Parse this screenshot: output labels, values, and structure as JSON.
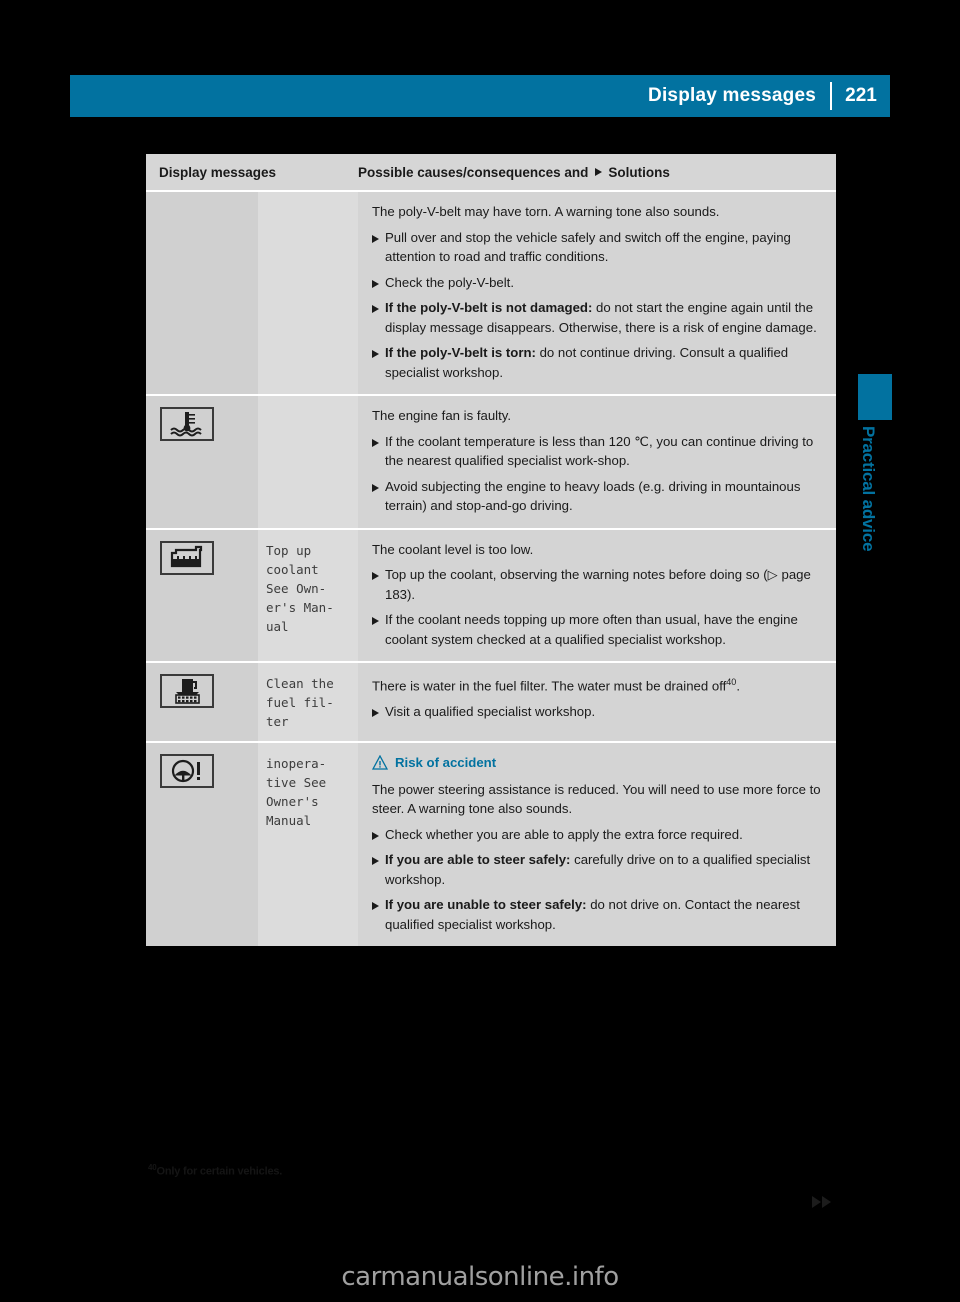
{
  "header": {
    "title": "Display messages",
    "page_number": "221",
    "accent_color": "#0272a0"
  },
  "sidebar": {
    "section_label": "Practical advice"
  },
  "table": {
    "columns": [
      "Display messages",
      "Possible causes/consequences and",
      "Solutions"
    ],
    "rows": [
      {
        "icon_name": "none",
        "display_message": "",
        "intro": "The poly-V-belt may have torn. A warning tone also sounds.",
        "warning": null,
        "bullets": [
          {
            "bold": "",
            "text": "Pull over and stop the vehicle safely and switch off the engine, paying attention to road and traffic conditions."
          },
          {
            "bold": "",
            "text": "Check the poly-V-belt."
          },
          {
            "bold": "If the poly-V-belt is not damaged:",
            "text": " do not start the engine again until the display message disappears. Otherwise, there is a risk of engine damage."
          },
          {
            "bold": "If the poly-V-belt is torn:",
            "text": " do not continue driving. Consult a qualified specialist workshop."
          }
        ]
      },
      {
        "icon_name": "coolant-temperature-icon",
        "display_message": "",
        "intro": "The engine fan is faulty.",
        "warning": null,
        "bullets": [
          {
            "bold": "",
            "text": "If the coolant temperature is less than 120 ℃, you can continue driving to the nearest qualified specialist work-shop."
          },
          {
            "bold": "",
            "text": "Avoid subjecting the engine to heavy loads (e.g. driving in mountainous terrain) and stop-and-go driving."
          }
        ]
      },
      {
        "icon_name": "coolant-reservoir-icon",
        "display_message": "Top up\ncoolant\nSee Own-\ner's Man-\nual",
        "intro": "The coolant level is too low.",
        "warning": null,
        "bullets": [
          {
            "bold": "",
            "text": "Top up the coolant, observing the warning notes before doing so (▷ page 183)."
          },
          {
            "bold": "",
            "text": "If the coolant needs topping up more often than usual, have the engine coolant system checked at a qualified specialist workshop."
          }
        ]
      },
      {
        "icon_name": "fuel-filter-icon",
        "display_message": "Clean the\nfuel fil-\nter",
        "intro": "There is water in the fuel filter. The water must be drained off",
        "intro_footnote": "40",
        "intro_tail": ".",
        "warning": null,
        "bullets": [
          {
            "bold": "",
            "text": "Visit a qualified specialist workshop."
          }
        ]
      },
      {
        "icon_name": "steering-wheel-warning-icon",
        "display_message": "inopera-\ntive See\nOwner's\nManual",
        "warning": "Risk of accident",
        "intro": "The power steering assistance is reduced. You will need to use more force to steer. A warning tone also sounds.",
        "bullets": [
          {
            "bold": "",
            "text": "Check whether you are able to apply the extra force required."
          },
          {
            "bold": "If you are able to steer safely:",
            "text": " carefully drive on to a qualified specialist workshop."
          },
          {
            "bold": "If you are unable to steer safely:",
            "text": " do not drive on. Contact the nearest qualified specialist workshop."
          }
        ]
      }
    ]
  },
  "footnote": {
    "marker": "40",
    "text": "Only for certain vehicles."
  },
  "watermark": "carmanualsonline.info"
}
